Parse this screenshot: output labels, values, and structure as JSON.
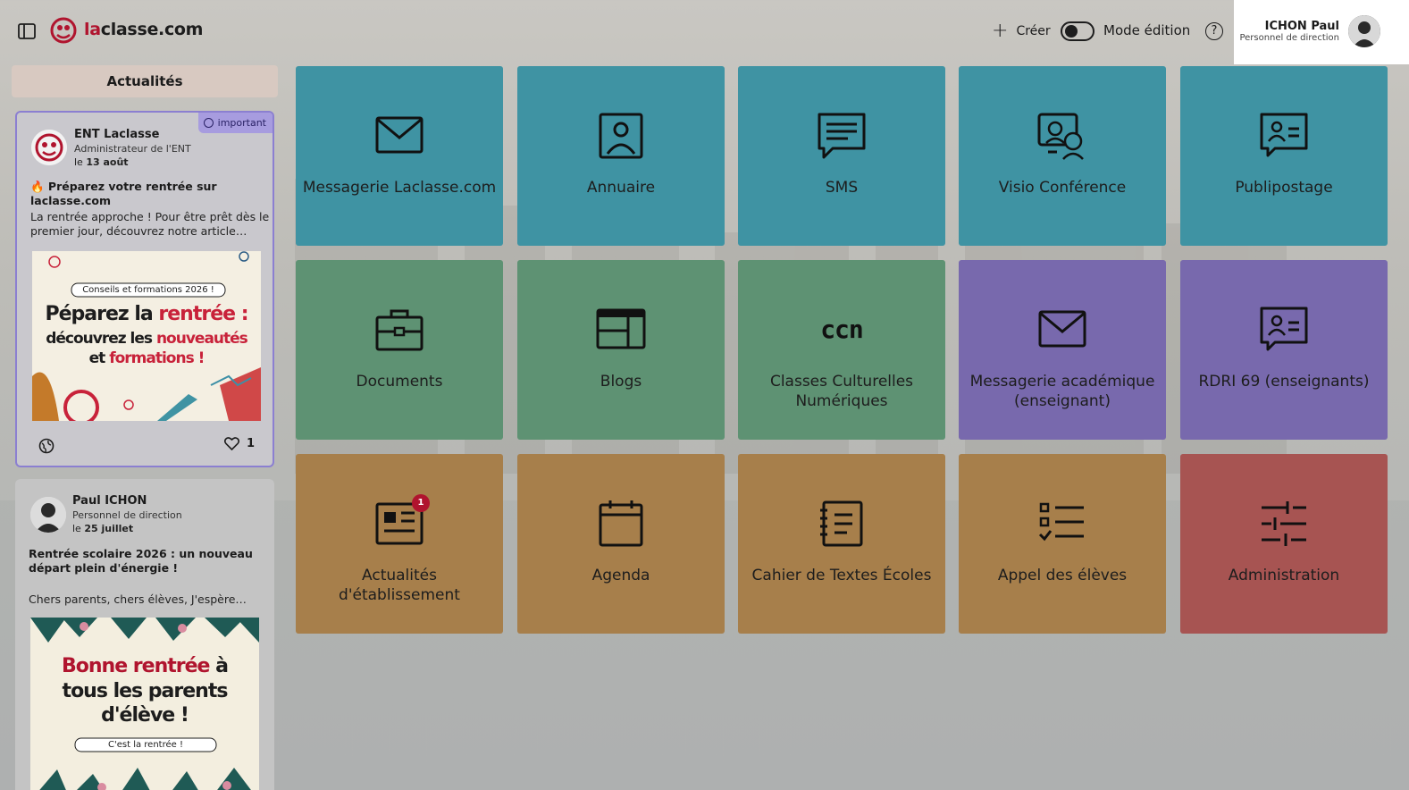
{
  "header": {
    "brand_prefix": "la",
    "brand_rest": "classe.com",
    "create_label": "Créer",
    "edit_mode_label": "Mode édition",
    "edit_mode_on": false,
    "help_symbol": "?",
    "user": {
      "name": "ICHON Paul",
      "role": "Personnel de direction"
    }
  },
  "news": {
    "title": "Actualités",
    "items": [
      {
        "important": true,
        "badge": "important",
        "author": "ENT Laclasse",
        "role": "Administrateur de l'ENT",
        "date_prefix": "le",
        "date": "13 août",
        "title": "🔥 Préparez votre rentrée sur laclasse.com",
        "excerpt": "La rentrée approche ! Pour être prêt dès le premier jour, découvrez notre article…",
        "image": {
          "pill": "Conseils et formations 2026 !",
          "line1a": "Péparez la",
          "line1b": "rentrée :",
          "line2a": "découvrez les",
          "line2b": "nouveautés",
          "line3a": "et",
          "line3b": "formations !"
        },
        "likes": "1"
      },
      {
        "important": false,
        "author": "Paul ICHON",
        "role": "Personnel de direction",
        "date_prefix": "le",
        "date": "25 juillet",
        "title": "Rentrée scolaire 2026 : un nouveau départ plein d'énergie !",
        "excerpt": "Chers parents, chers élèves, J'espère…",
        "image": {
          "line1a": "Bonne rentrée",
          "line1b": "à",
          "line2": "tous les parents",
          "line3": "d'élève !",
          "pill": "C'est la rentrée !"
        }
      }
    ]
  },
  "tiles": [
    {
      "label": "Messagerie Laclasse.com",
      "icon": "envelope-icon",
      "color": "#3f93a3"
    },
    {
      "label": "Annuaire",
      "icon": "contact-icon",
      "color": "#3f93a3"
    },
    {
      "label": "SMS",
      "icon": "message-icon",
      "color": "#3f93a3"
    },
    {
      "label": "Visio Conférence",
      "icon": "video-meeting-icon",
      "color": "#3f93a3"
    },
    {
      "label": "Publipostage",
      "icon": "mail-merge-icon",
      "color": "#3f93a3"
    },
    {
      "label": "Documents",
      "icon": "briefcase-icon",
      "color": "#5e9273"
    },
    {
      "label": "Blogs",
      "icon": "layout-icon",
      "color": "#5e9273"
    },
    {
      "label": "Classes Culturelles Numériques",
      "icon": "ccn-logo-icon",
      "icon_text": "ccn",
      "color": "#5e9273"
    },
    {
      "label": "Messagerie académique (enseignant)",
      "icon": "envelope-icon",
      "color": "#7869ad"
    },
    {
      "label": "RDRI 69 (enseignants)",
      "icon": "id-card-icon",
      "color": "#7869ad"
    },
    {
      "label": "Actualités d'établissement",
      "icon": "newspaper-icon",
      "badge": "1",
      "color": "#a77f4b"
    },
    {
      "label": "Agenda",
      "icon": "calendar-icon",
      "color": "#a77f4b"
    },
    {
      "label": "Cahier de Textes Écoles",
      "icon": "notebook-icon",
      "color": "#a77f4b"
    },
    {
      "label": "Appel des élèves",
      "icon": "checklist-icon",
      "color": "#a77f4b"
    },
    {
      "label": "Administration",
      "icon": "sliders-icon",
      "color": "#a75452"
    }
  ]
}
